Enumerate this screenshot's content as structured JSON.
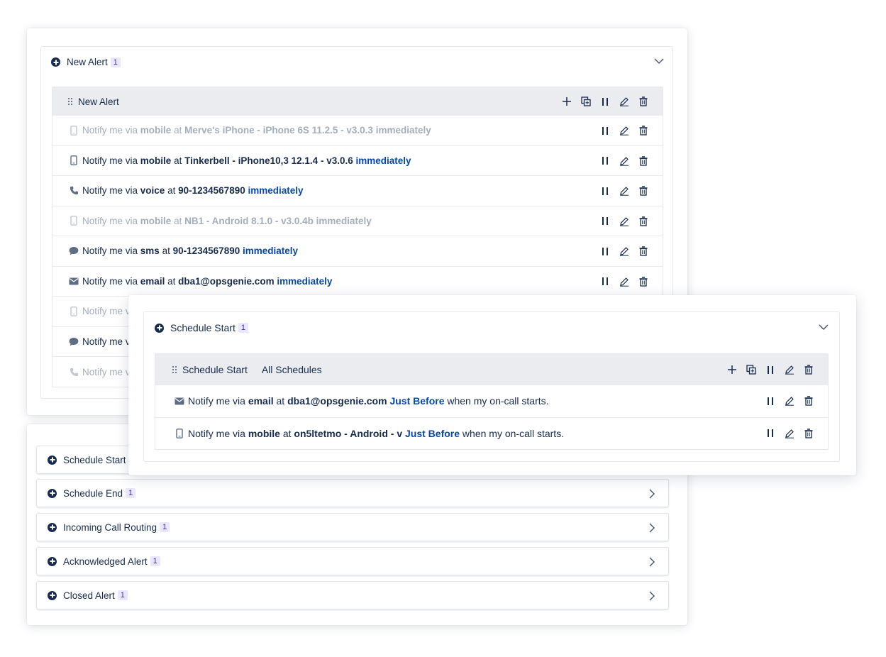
{
  "new_alert_section": {
    "title": "New Alert",
    "badge": "1",
    "group": {
      "title": "New Alert",
      "rules": [
        {
          "icon": "mobile-icon",
          "dim": true,
          "prefix": "Notify me via",
          "method": "mobile",
          "at": "at",
          "target": "Merve's iPhone - iPhone 6S 11.2.5 - v3.0.3",
          "timing": "immediately"
        },
        {
          "icon": "mobile-icon",
          "dim": false,
          "prefix": "Notify me via",
          "method": "mobile",
          "at": "at",
          "target": "Tinkerbell - iPhone10,3 12.1.4 - v3.0.6",
          "timing": "immediately"
        },
        {
          "icon": "phone-icon",
          "dim": false,
          "prefix": "Notify me via",
          "method": "voice",
          "at": "at",
          "target": "90-1234567890",
          "timing": "immediately"
        },
        {
          "icon": "mobile-icon",
          "dim": true,
          "prefix": "Notify me via",
          "method": "mobile",
          "at": "at",
          "target": "NB1 - Android 8.1.0 - v3.0.4b",
          "timing": "immediately"
        },
        {
          "icon": "chat-icon",
          "dim": false,
          "prefix": "Notify me via",
          "method": "sms",
          "at": "at",
          "target": "90-1234567890",
          "timing": "immediately"
        },
        {
          "icon": "email-icon",
          "dim": false,
          "prefix": "Notify me via",
          "method": "email",
          "at": "at",
          "target": "dba1@opsgenie.com",
          "timing": "immediately"
        },
        {
          "icon": "mobile-icon",
          "dim": true,
          "prefix": "Notify me v"
        },
        {
          "icon": "chat-icon",
          "dim": false,
          "prefix": "Notify me v"
        },
        {
          "icon": "phone-icon",
          "dim": true,
          "prefix": "Notify me v"
        }
      ]
    }
  },
  "collapsed_sections": [
    {
      "title": "Schedule Start",
      "badge": ""
    },
    {
      "title": "Schedule End",
      "badge": "1"
    },
    {
      "title": "Incoming Call Routing",
      "badge": "1"
    },
    {
      "title": "Acknowledged Alert",
      "badge": "1"
    },
    {
      "title": "Closed Alert",
      "badge": "1"
    }
  ],
  "schedule_start_section": {
    "title": "Schedule Start",
    "badge": "1",
    "group": {
      "title": "Schedule Start",
      "scope": "All Schedules",
      "rules": [
        {
          "icon": "email-icon",
          "prefix": "Notify me via",
          "method": "email",
          "at": "at",
          "target": "dba1@opsgenie.com",
          "timing": "Just Before",
          "suffix": "when my on-call starts."
        },
        {
          "icon": "mobile-icon",
          "prefix": "Notify me via",
          "method": "mobile",
          "at": "at",
          "target": "on5ltetmo - Android - v",
          "timing": "Just Before",
          "suffix": "when my on-call starts."
        }
      ]
    }
  },
  "colors": {
    "text": "#172b4d",
    "accent": "#0747a6",
    "dim": "#a5adba",
    "badge_bg": "#eae6ff",
    "header_bg": "#ebecf0"
  }
}
